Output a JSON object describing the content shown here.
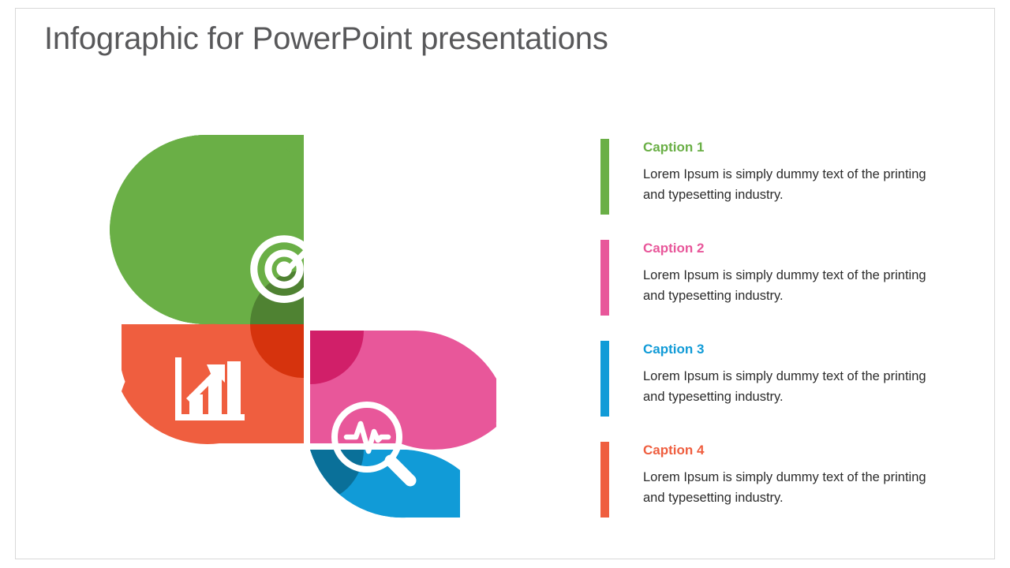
{
  "slide": {
    "title": "Infographic for PowerPoint presentations",
    "title_color": "#58585a",
    "background": "#ffffff",
    "border_color": "#d8d8d8"
  },
  "palette": {
    "green": "#6AAF46",
    "green_dark": "#4F8232",
    "pink": "#E8579A",
    "pink_dark": "#D11F69",
    "blue": "#119BD7",
    "blue_dark": "#0A7099",
    "orange": "#EF5E3F",
    "orange_dark": "#D6330D"
  },
  "pinwheel": {
    "petals": [
      {
        "id": "petal-green",
        "position": "top-left",
        "color": "#6AAF46",
        "overlap_color": "#4F8232",
        "icon": "target-arrow-icon",
        "caption_ref": "Caption 1"
      },
      {
        "id": "petal-pink",
        "position": "top-right",
        "color": "#E8579A",
        "overlap_color": "#D11F69",
        "icon": "strategy-playbook-icon",
        "caption_ref": "Caption 2"
      },
      {
        "id": "petal-blue",
        "position": "bottom-right",
        "color": "#119BD7",
        "overlap_color": "#0A7099",
        "icon": "magnifier-pulse-icon",
        "caption_ref": "Caption 3"
      },
      {
        "id": "petal-orange",
        "position": "bottom-left",
        "color": "#EF5E3F",
        "overlap_color": "#D6330D",
        "icon": "bar-chart-growth-icon",
        "caption_ref": "Caption 4"
      }
    ]
  },
  "captions": [
    {
      "title": "Caption 1",
      "text": "Lorem Ipsum is simply dummy text of the printing and typesetting industry.",
      "color": "#6AAF46"
    },
    {
      "title": "Caption 2",
      "text": "Lorem Ipsum is simply dummy text of the printing and typesetting industry.",
      "color": "#E8579A"
    },
    {
      "title": "Caption 3",
      "text": "Lorem Ipsum is simply dummy text of the printing and typesetting industry.",
      "color": "#119BD7"
    },
    {
      "title": "Caption 4",
      "text": "Lorem Ipsum is simply dummy text of the printing and typesetting industry.",
      "color": "#EF5E3F"
    }
  ]
}
